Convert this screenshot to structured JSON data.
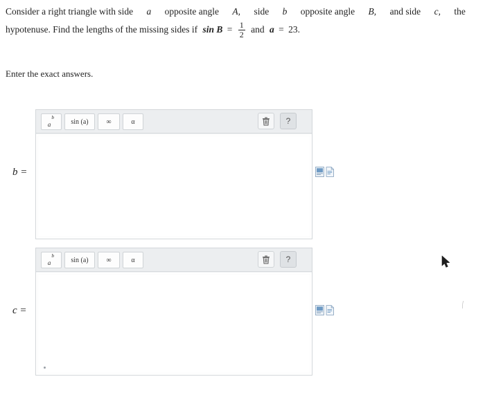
{
  "problem": {
    "line1_part1": "Consider a right triangle with side",
    "var_a": "a",
    "line1_part2": "opposite angle",
    "var_A": "A,",
    "line1_part3": "side",
    "var_b": "b",
    "line1_part4": "opposite angle",
    "var_B": "B,",
    "line1_part5": "and side",
    "var_c": "c,",
    "line1_part6": "the",
    "line2_part1": "hypotenuse. Find the lengths of the missing sides if",
    "sin_b": "sin B",
    "equals": "=",
    "fraction_numerator": "1",
    "fraction_denominator": "2",
    "and": "and",
    "a_label": "a",
    "a_equals": "=",
    "a_value": "23."
  },
  "instruction": "Enter the exact answers.",
  "editors": [
    {
      "label": "b =",
      "toolbar": {
        "superscript_button": "a^b",
        "superscript_base": "a",
        "superscript_exp": "b",
        "sin_button": "sin (a)",
        "infinity_button": "∞",
        "alpha_button": "α",
        "trash_button": "trash-icon",
        "help_button": "?"
      },
      "answer_value": ""
    },
    {
      "label": "c =",
      "toolbar": {
        "superscript_button": "a^b",
        "superscript_base": "a",
        "superscript_exp": "b",
        "sin_button": "sin (a)",
        "infinity_button": "∞",
        "alpha_button": "α",
        "trash_button": "trash-icon",
        "help_button": "?"
      },
      "answer_value": ""
    }
  ],
  "colors": {
    "toolbar_bg": "#eceef0",
    "border": "#d3d7da",
    "page_bg": "#ffffff",
    "text": "#222222",
    "icon_blue": "#4a7fb5"
  }
}
